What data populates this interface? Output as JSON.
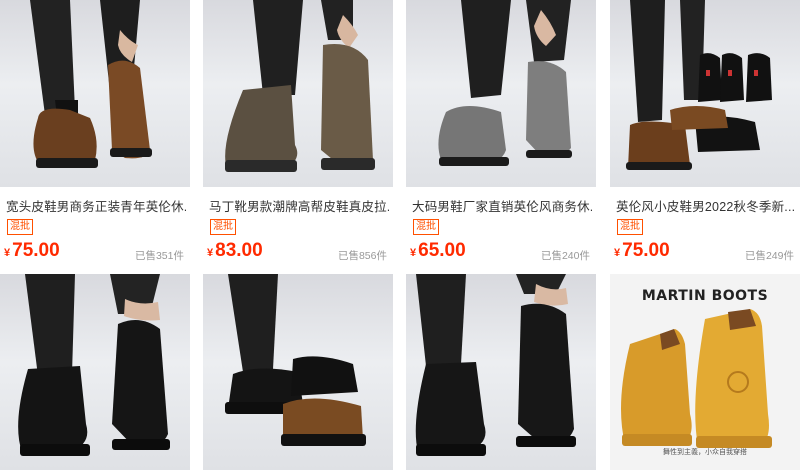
{
  "products": [
    {
      "title": "宽头皮鞋男商务正装青年英伦休...",
      "badge": "混批",
      "currency": "¥",
      "price": "75.00",
      "sold": "已售351件",
      "image": "brown-derby-shoes-photo"
    },
    {
      "title": "马丁靴男款潮牌高帮皮鞋真皮拉...",
      "badge": "混批",
      "currency": "¥",
      "price": "83.00",
      "sold": "已售856件",
      "image": "suede-lace-up-boots-photo"
    },
    {
      "title": "大码男鞋厂家直销英伦风商务休...",
      "badge": "混批",
      "currency": "¥",
      "price": "65.00",
      "sold": "已售240件",
      "image": "grey-leather-derby-photo"
    },
    {
      "title": "英伦风小皮鞋男2022秋冬季新...",
      "badge": "混批",
      "currency": "¥",
      "price": "75.00",
      "sold": "已售249件",
      "image": "assorted-shoes-photo"
    },
    {
      "image": "black-brogue-shoes-photo"
    },
    {
      "image": "black-and-brown-derby-photo"
    },
    {
      "image": "black-loafers-photo"
    },
    {
      "image": "yellow-martin-boots-ad",
      "ad_title": "MARTIN BOOTS",
      "ad_caption": "舞性到主義，小众自我穿搭"
    }
  ],
  "colors": {
    "price": "#ff2a00",
    "badge": "#ff5000",
    "sold": "#999999"
  }
}
